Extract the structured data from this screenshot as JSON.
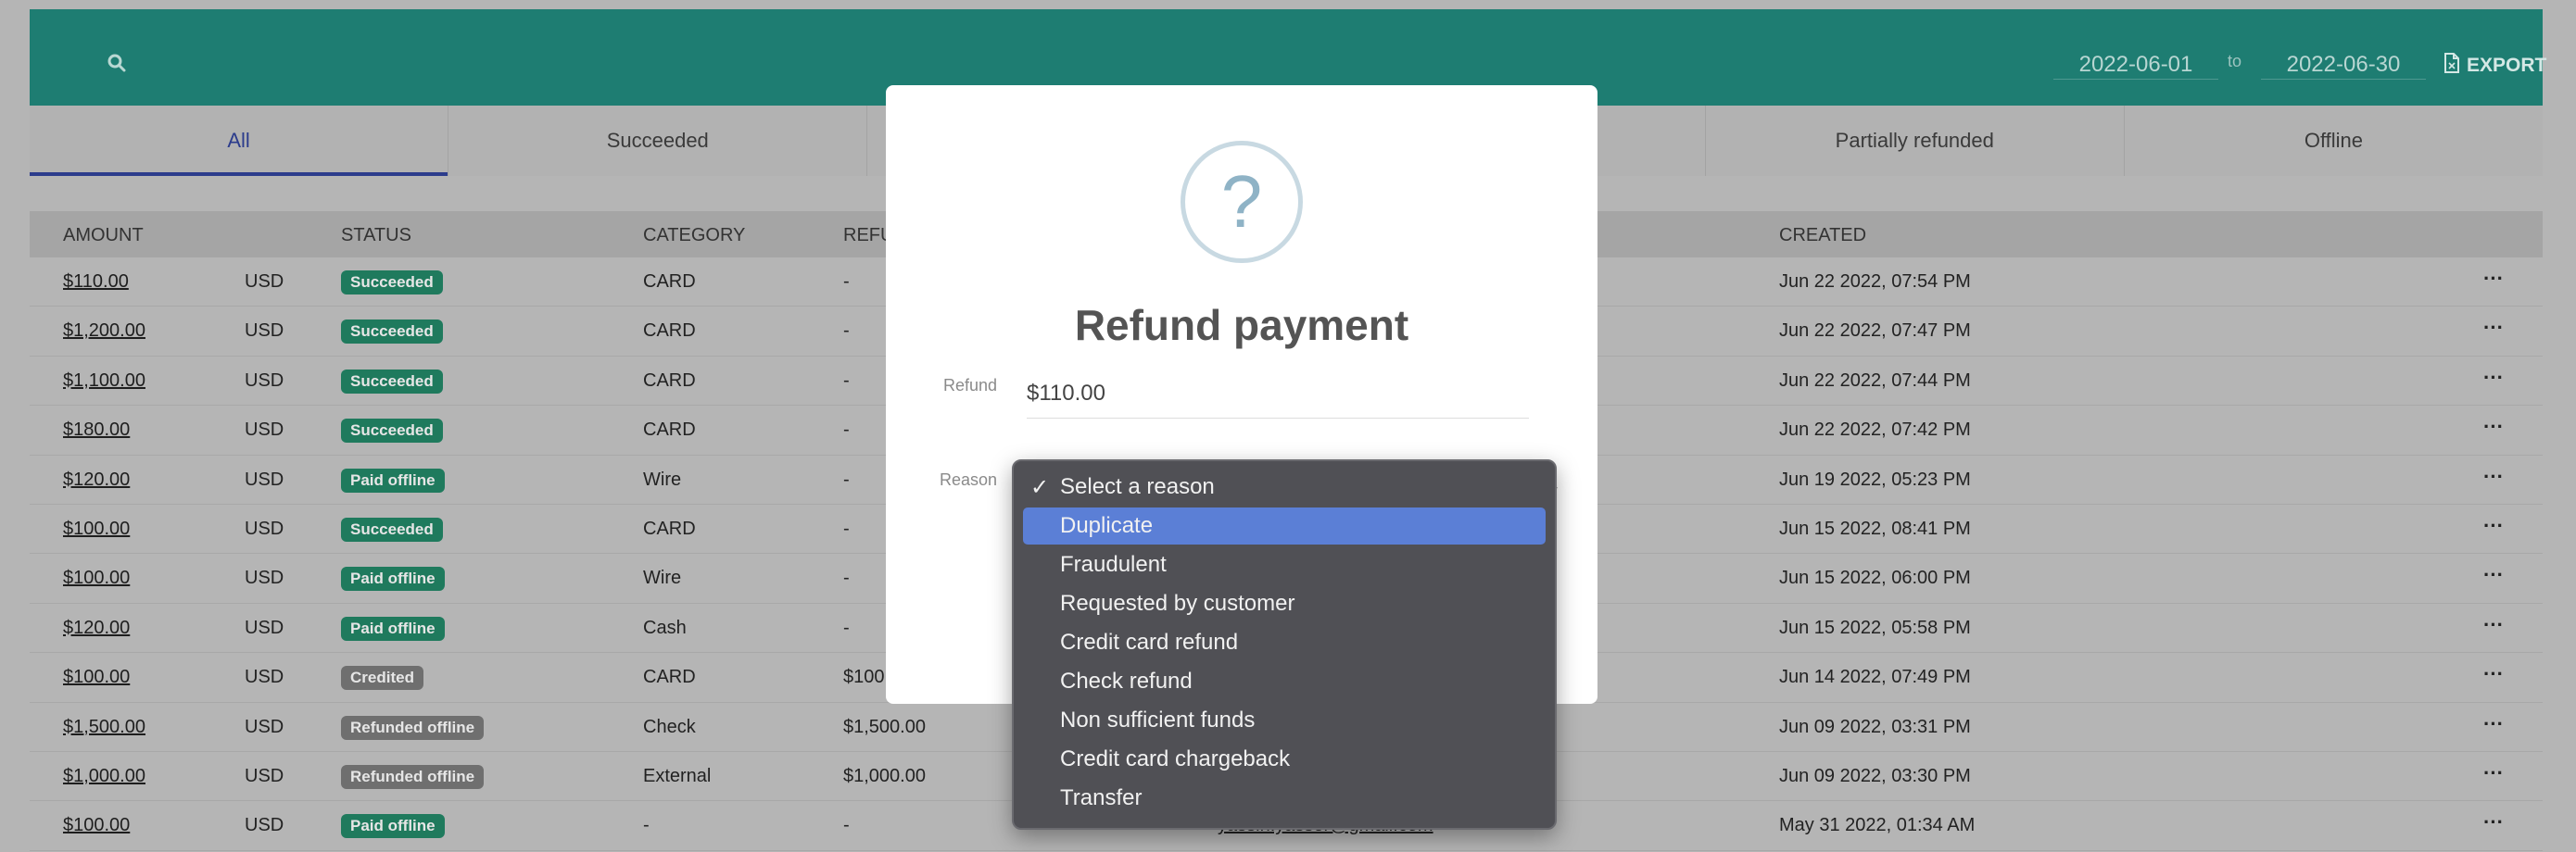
{
  "header": {
    "date_from": "2022-06-01",
    "date_sep": "to",
    "date_to": "2022-06-30",
    "export_label": "EXPORT"
  },
  "tabs": [
    {
      "label": "All",
      "active": true
    },
    {
      "label": "Succeeded"
    },
    {
      "label": ""
    },
    {
      "label": ""
    },
    {
      "label": "Partially refunded"
    },
    {
      "label": "Offline"
    }
  ],
  "table": {
    "headers": {
      "amount": "AMOUNT",
      "status": "STATUS",
      "category": "CATEGORY",
      "refund": "REFU",
      "created": "CREATED"
    },
    "rows": [
      {
        "amount": "$110.00",
        "currency": "USD",
        "status": "Succeeded",
        "category": "CARD",
        "refund": "-",
        "created": "Jun 22 2022, 07:54 PM"
      },
      {
        "amount": "$1,200.00",
        "currency": "USD",
        "status": "Succeeded",
        "category": "CARD",
        "refund": "-",
        "created": "Jun 22 2022, 07:47 PM"
      },
      {
        "amount": "$1,100.00",
        "currency": "USD",
        "status": "Succeeded",
        "category": "CARD",
        "refund": "-",
        "created": "Jun 22 2022, 07:44 PM"
      },
      {
        "amount": "$180.00",
        "currency": "USD",
        "status": "Succeeded",
        "category": "CARD",
        "refund": "-",
        "created": "Jun 22 2022, 07:42 PM"
      },
      {
        "amount": "$120.00",
        "currency": "USD",
        "status": "Paid offline",
        "category": "Wire",
        "refund": "-",
        "created": "Jun 19 2022, 05:23 PM"
      },
      {
        "amount": "$100.00",
        "currency": "USD",
        "status": "Succeeded",
        "category": "CARD",
        "refund": "-",
        "created": "Jun 15 2022, 08:41 PM"
      },
      {
        "amount": "$100.00",
        "currency": "USD",
        "status": "Paid offline",
        "category": "Wire",
        "refund": "-",
        "created": "Jun 15 2022, 06:00 PM"
      },
      {
        "amount": "$120.00",
        "currency": "USD",
        "status": "Paid offline",
        "category": "Cash",
        "refund": "-",
        "created": "Jun 15 2022, 05:58 PM"
      },
      {
        "amount": "$100.00",
        "currency": "USD",
        "status": "Credited",
        "category": "CARD",
        "refund": "$100",
        "created": "Jun 14 2022, 07:49 PM"
      },
      {
        "amount": "$1,500.00",
        "currency": "USD",
        "status": "Refunded offline",
        "category": "Check",
        "refund": "$1,500.00",
        "created": "Jun 09 2022, 03:31 PM"
      },
      {
        "amount": "$1,000.00",
        "currency": "USD",
        "status": "Refunded offline",
        "category": "External",
        "refund": "$1,000.00",
        "created": "Jun 09 2022, 03:30 PM"
      },
      {
        "amount": "$100.00",
        "currency": "USD",
        "status": "Paid offline",
        "category": "-",
        "refund": "-",
        "customer": "yassin.yasser@gmail.com",
        "created": "May 31 2022, 01:34 AM"
      }
    ],
    "more_glyph": "···"
  },
  "modal": {
    "icon_glyph": "?",
    "title": "Refund payment",
    "refund_label": "Refund",
    "refund_value": "$110.00",
    "reason_label": "Reason"
  },
  "dropdown": {
    "options": [
      {
        "label": "Select a reason",
        "checked": true
      },
      {
        "label": "Duplicate",
        "highlighted": true
      },
      {
        "label": "Fraudulent"
      },
      {
        "label": "Requested by customer"
      },
      {
        "label": "Credit card refund"
      },
      {
        "label": "Check refund"
      },
      {
        "label": "Non sufficient funds"
      },
      {
        "label": "Credit card chargeback"
      },
      {
        "label": "Transfer"
      }
    ],
    "check_glyph": "✓"
  },
  "colors": {
    "header": "#1e7d72",
    "badge_green": "#1f7a5d",
    "badge_gray": "#6f6f6f",
    "highlight": "#5b7fd6"
  }
}
